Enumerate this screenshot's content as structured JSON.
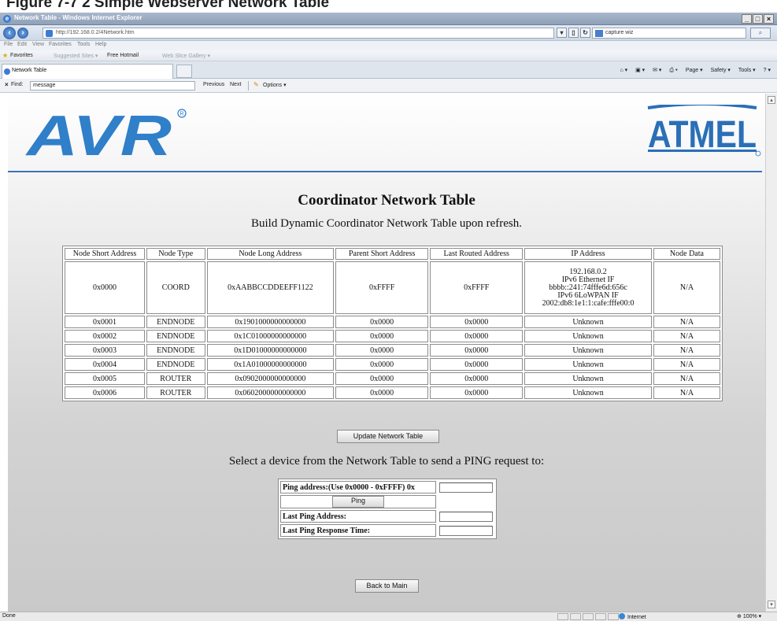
{
  "figure_title": "Figure 7-7 2 Simple Webserver Network Table",
  "browser": {
    "window_title": "Network Table - Windows Internet Explorer",
    "url": "http://192.168.0.2/4Network.htm",
    "search_text": "capture wiz",
    "menu": [
      "File",
      "Edit",
      "View",
      "Favorites",
      "Tools",
      "Help"
    ],
    "favorites_label": "Favorites",
    "favorites_links": [
      "Suggested Sites ▾",
      "Free Hotmail",
      "Web Slice Gallery ▾"
    ],
    "tab_label": "Network Table",
    "command_items": [
      "Page ▾",
      "Safety ▾",
      "Tools ▾"
    ],
    "find_label": "Find:",
    "find_value": "message",
    "find_prev": "Previous",
    "find_next": "Next",
    "find_options": "Options ▾",
    "status_text": "Done",
    "zone_text": "Internet",
    "zoom_text": "100%"
  },
  "page": {
    "avr_logo_text": "AVR",
    "atmel_logo_text": "ATMEL",
    "heading": "Coordinator Network Table",
    "subheading": "Build Dynamic Coordinator Network Table upon refresh.",
    "table": {
      "columns": [
        "Node Short Address",
        "Node Type",
        "Node Long Address",
        "Parent Short Address",
        "Last Routed Address",
        "IP Address",
        "Node Data"
      ],
      "coord_row": {
        "short": "0x0000",
        "type": "COORD",
        "long": "0xAABBCCDDEEFF1122",
        "parent": "0xFFFF",
        "routed": "0xFFFF",
        "ip_lines": [
          "192.168.0.2",
          "IPv6 Ethernet IF",
          "bbbb::241:74fffe6d:656c",
          "IPv6 6LoWPAN IF",
          "2002:db8:1e1:1:cafe:fffe00:0"
        ],
        "data": "N/A"
      },
      "rows": [
        {
          "short": "0x0001",
          "type": "ENDNODE",
          "long": "0x1901000000000000",
          "parent": "0x0000",
          "routed": "0x0000",
          "ip": "Unknown",
          "data": "N/A"
        },
        {
          "short": "0x0002",
          "type": "ENDNODE",
          "long": "0x1C01000000000000",
          "parent": "0x0000",
          "routed": "0x0000",
          "ip": "Unknown",
          "data": "N/A"
        },
        {
          "short": "0x0003",
          "type": "ENDNODE",
          "long": "0x1D01000000000000",
          "parent": "0x0000",
          "routed": "0x0000",
          "ip": "Unknown",
          "data": "N/A"
        },
        {
          "short": "0x0004",
          "type": "ENDNODE",
          "long": "0x1A01000000000000",
          "parent": "0x0000",
          "routed": "0x0000",
          "ip": "Unknown",
          "data": "N/A"
        },
        {
          "short": "0x0005",
          "type": "ROUTER",
          "long": "0x0902000000000000",
          "parent": "0x0000",
          "routed": "0x0000",
          "ip": "Unknown",
          "data": "N/A"
        },
        {
          "short": "0x0006",
          "type": "ROUTER",
          "long": "0x0602000000000000",
          "parent": "0x0000",
          "routed": "0x0000",
          "ip": "Unknown",
          "data": "N/A"
        }
      ]
    },
    "update_button": "Update Network Table",
    "ping_prompt": "Select a device from the Network Table to send a PING request to:",
    "ping": {
      "address_label": "Ping address:(Use 0x0000 - 0xFFFF) 0x",
      "button": "Ping",
      "last_address_label": "Last Ping Address:",
      "last_time_label": "Last Ping Response Time:"
    },
    "back_button": "Back to Main"
  },
  "colors": {
    "avr_blue": "#2f7fc9",
    "atmel_blue": "#2a6fb8",
    "rule_blue": "#3b74b8"
  }
}
